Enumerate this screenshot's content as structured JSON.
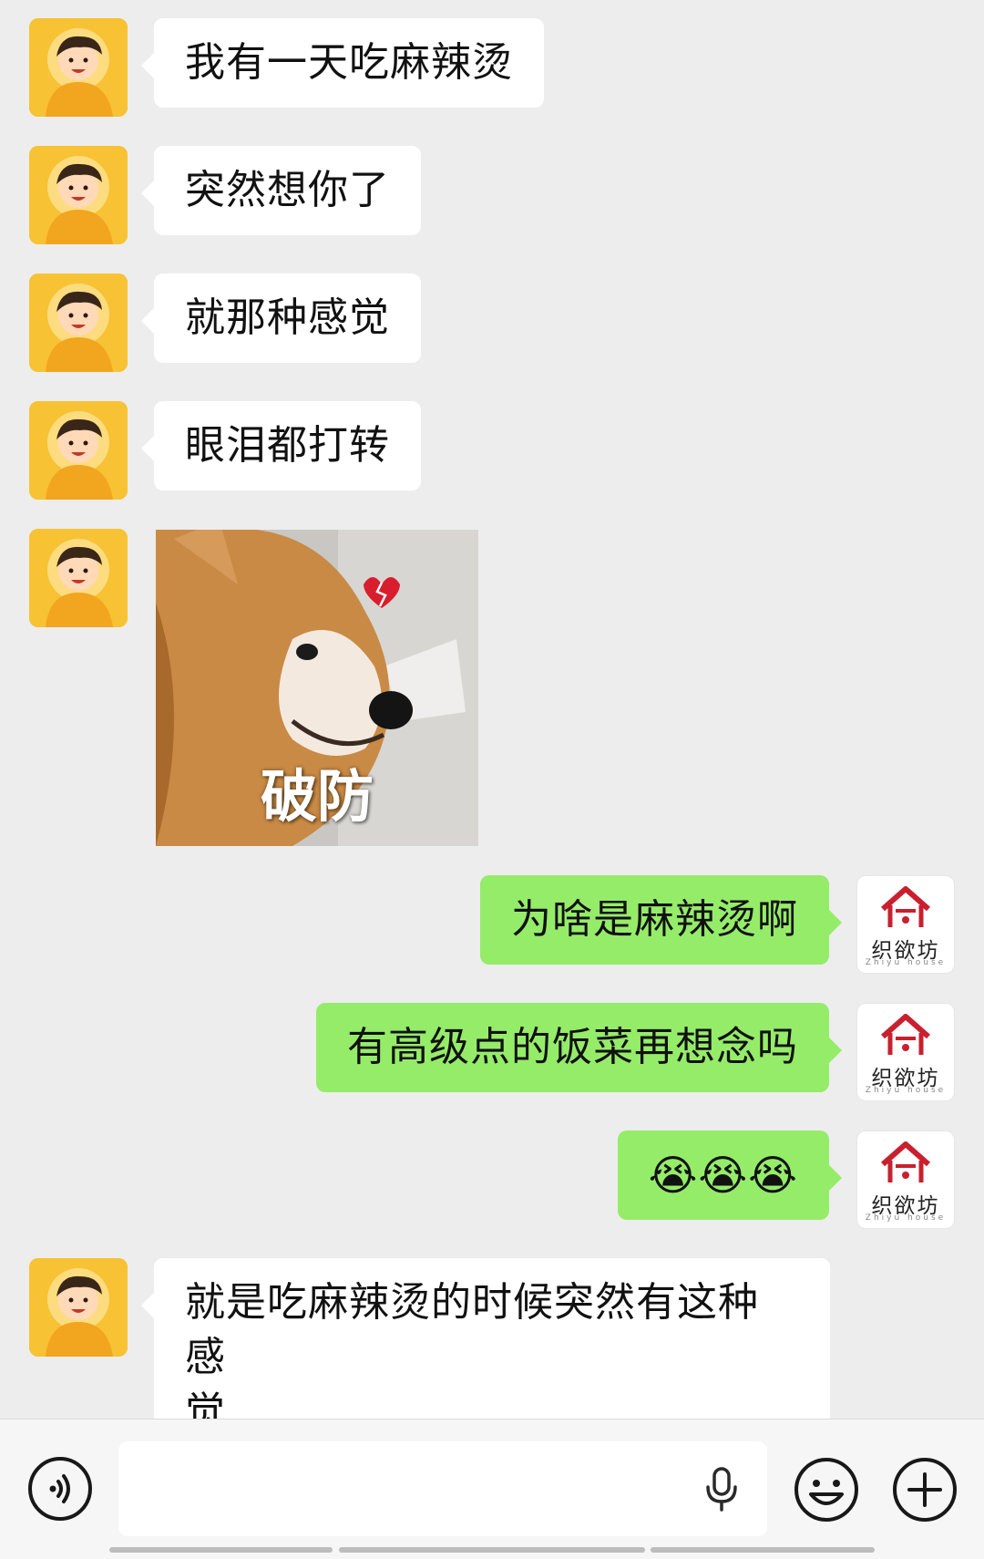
{
  "messages": [
    {
      "side": "left",
      "type": "text",
      "text": "我有一天吃麻辣烫"
    },
    {
      "side": "left",
      "type": "text",
      "text": "突然想你了"
    },
    {
      "side": "left",
      "type": "text",
      "text": "就那种感觉"
    },
    {
      "side": "left",
      "type": "text",
      "text": "眼泪都打转"
    },
    {
      "side": "left",
      "type": "sticker",
      "caption": "破防"
    },
    {
      "side": "right",
      "type": "text",
      "text": "为啥是麻辣烫啊"
    },
    {
      "side": "right",
      "type": "text",
      "text": "有高级点的饭菜再想念吗"
    },
    {
      "side": "right",
      "type": "emoji",
      "text": "😭😭😭"
    },
    {
      "side": "left",
      "type": "text",
      "text_line1": "就是吃麻辣烫的时候突然有这种感",
      "text_line2": "觉"
    }
  ],
  "self_avatar": {
    "brand": "织欲坊",
    "brand_sub": "Zhiyu house"
  },
  "input_bar": {
    "voice_icon": "voice-wave-icon",
    "mic_icon": "microphone-icon",
    "emoji_icon": "smiley-icon",
    "more_icon": "plus-circle-icon",
    "placeholder": ""
  },
  "colors": {
    "background": "#ededed",
    "self_bubble": "#95ec69",
    "other_bubble": "#ffffff",
    "brand_red": "#c8202f"
  }
}
